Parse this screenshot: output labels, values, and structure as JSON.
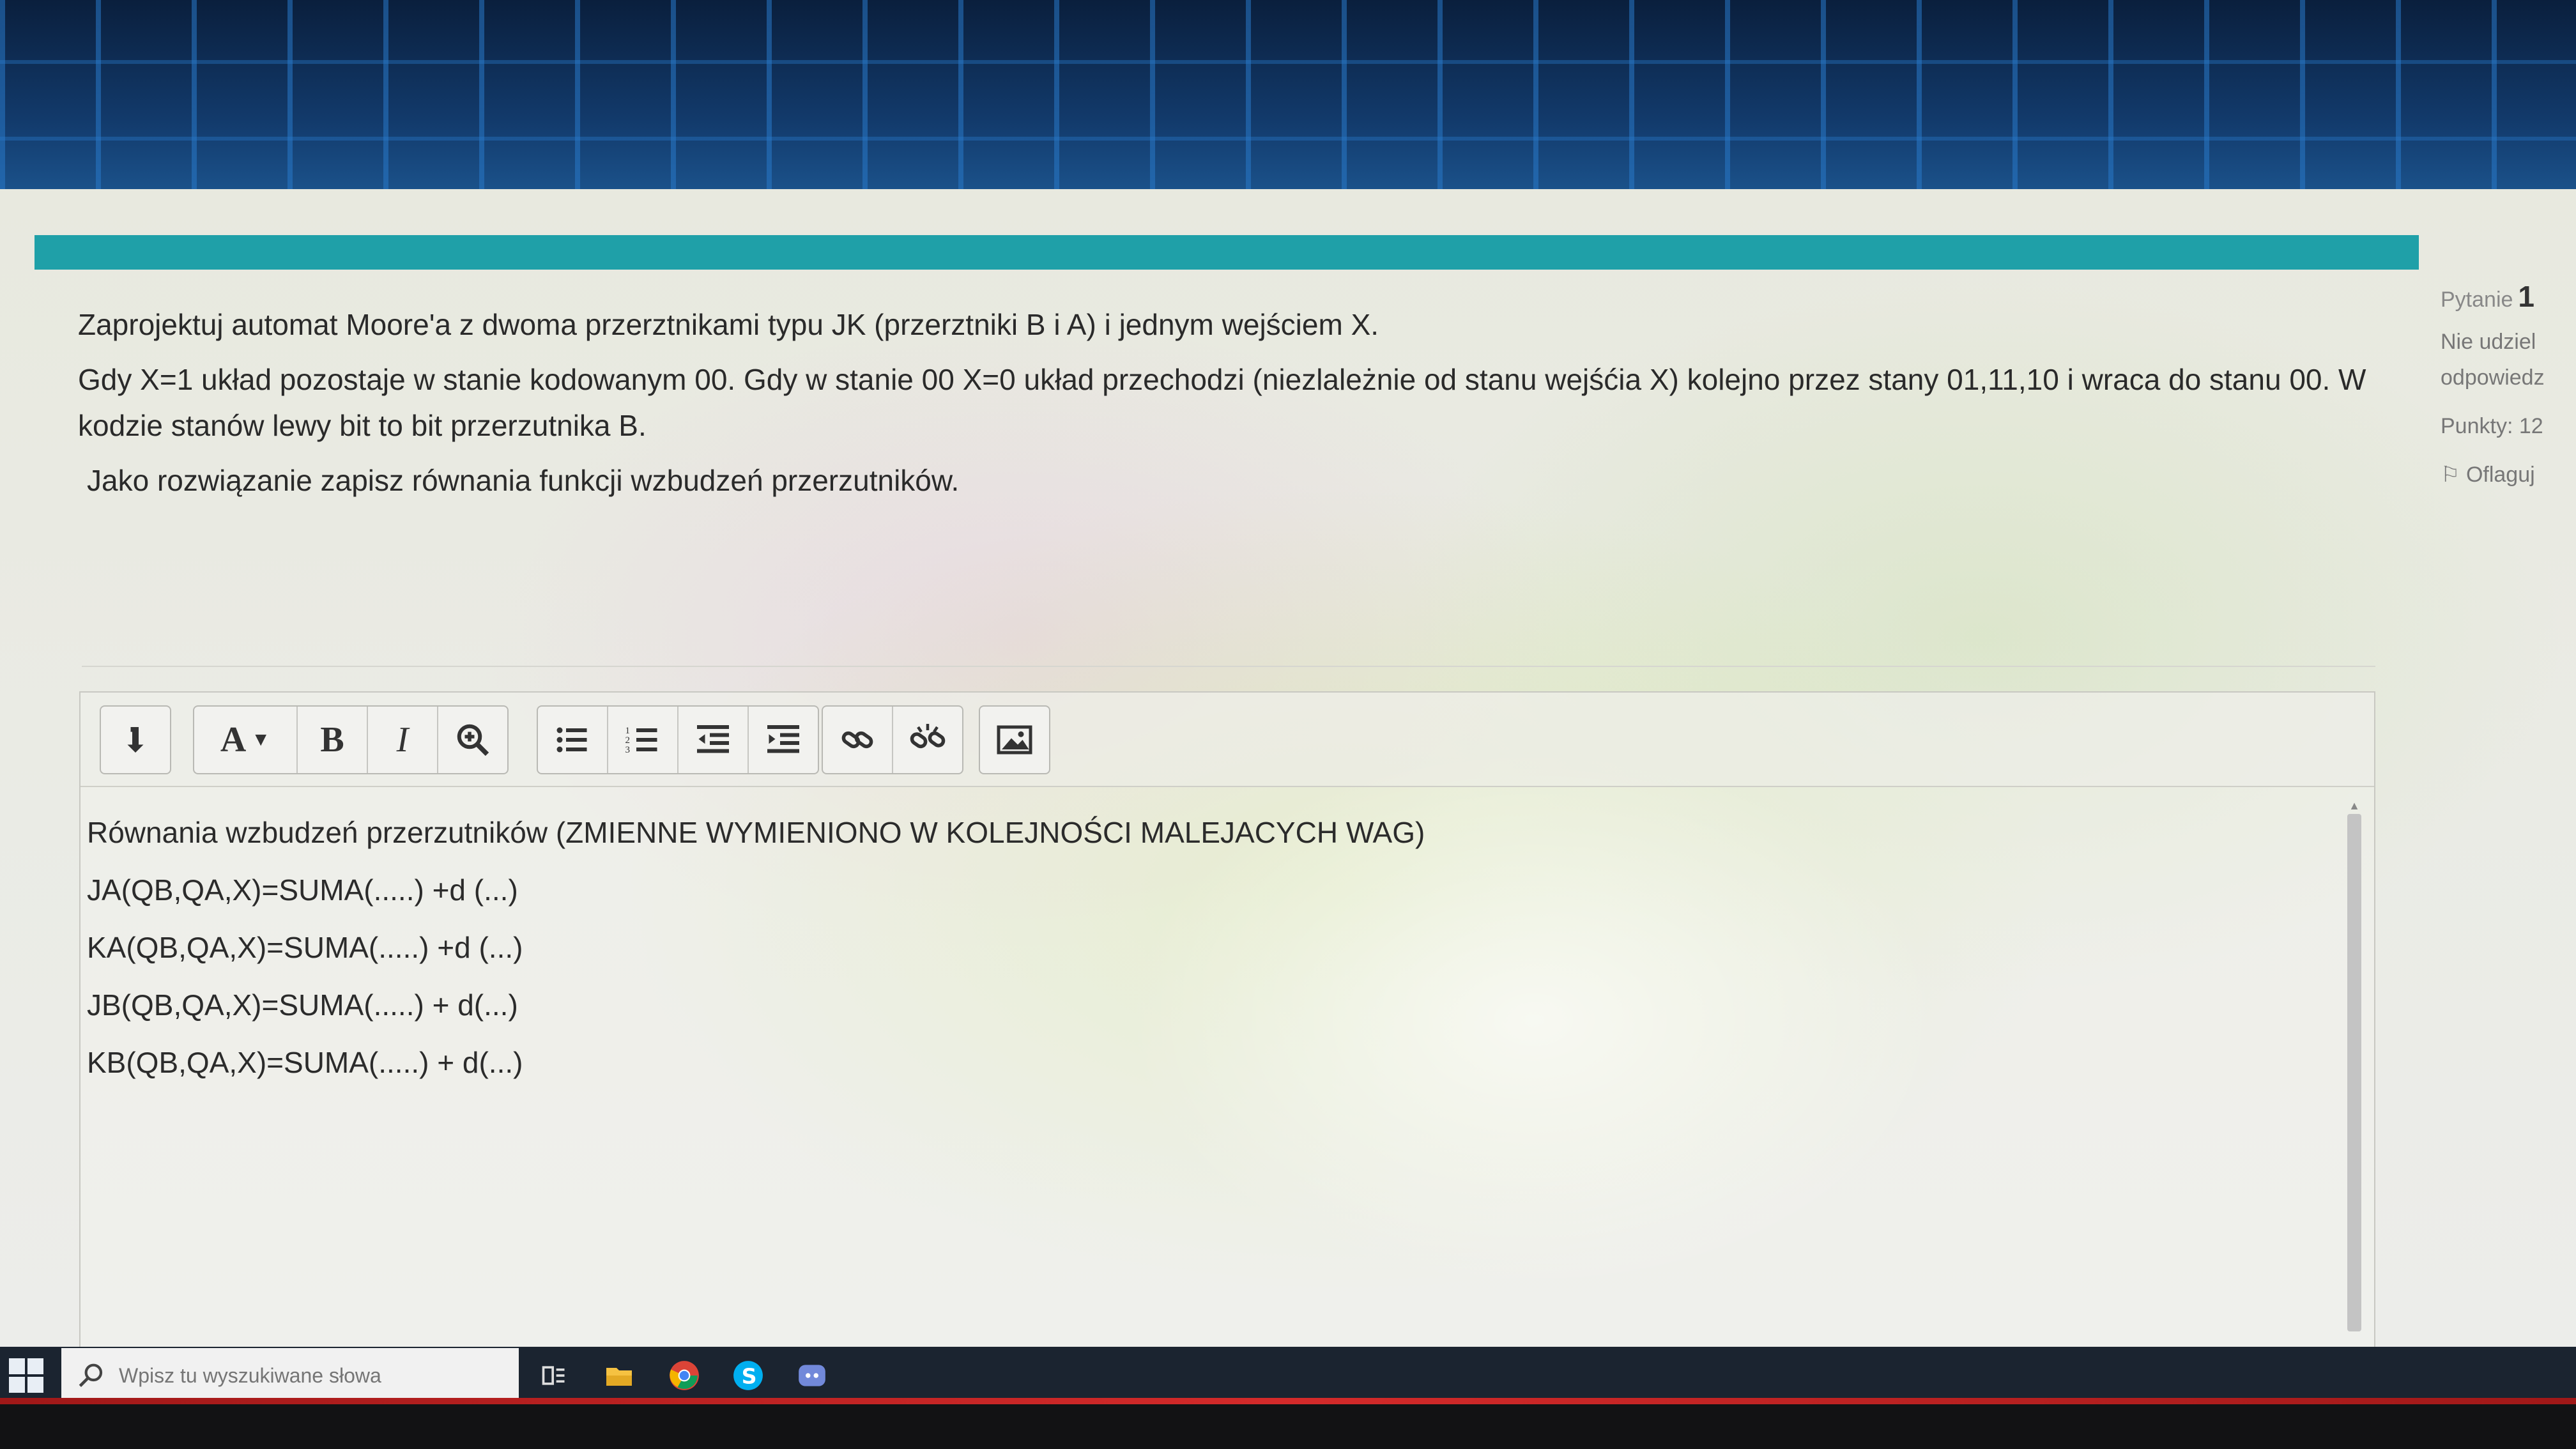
{
  "question": {
    "line1": "Zaprojektuj automat Moore'a z dwoma przerztnikami typu JK  (przerztniki B i A) i jednym wejściem X.",
    "line2a": "Gdy X=1 układ pozostaje w stanie  kodowanym  00. Gdy w stanie 00  X=0  układ przechodzi (niezlależnie od stanu wejśćia X) kolejno przez stany 01,11,10 i wraca do stanu 00. W",
    "line2b": "kodzie stanów lewy bit to bit przerzutnika B.",
    "line3": "Jako rozwiązanie zapisz równania funkcji wzbudzeń przerzutników."
  },
  "editor": {
    "lines": [
      "Równania wzbudzeń przerzutników (ZMIENNE WYMIENIONO W KOLEJNOŚCI MALEJACYCH WAG)",
      "JA(QB,QA,X)=SUMA(.....) +d (...)",
      "KA(QB,QA,X)=SUMA(.....) +d (...)",
      "JB(QB,QA,X)=SUMA(.....) + d(...)",
      "KB(QB,QA,X)=SUMA(.....) + d(...)"
    ],
    "toolbar": {
      "font_label": "A",
      "bold_label": "B",
      "italic_label": "I"
    }
  },
  "side": {
    "question_label": "Pytanie",
    "question_number": "1",
    "status_line1": "Nie udziel",
    "status_line2": "odpowiedz",
    "points": "Punkty: 12",
    "flag": "Oflaguj"
  },
  "taskbar": {
    "search_placeholder": "Wpisz tu wyszukiwane słowa"
  },
  "colors": {
    "teal_header": "#1fa0a8",
    "taskbar": "#1b2430",
    "red_strip": "#d42a2a"
  }
}
